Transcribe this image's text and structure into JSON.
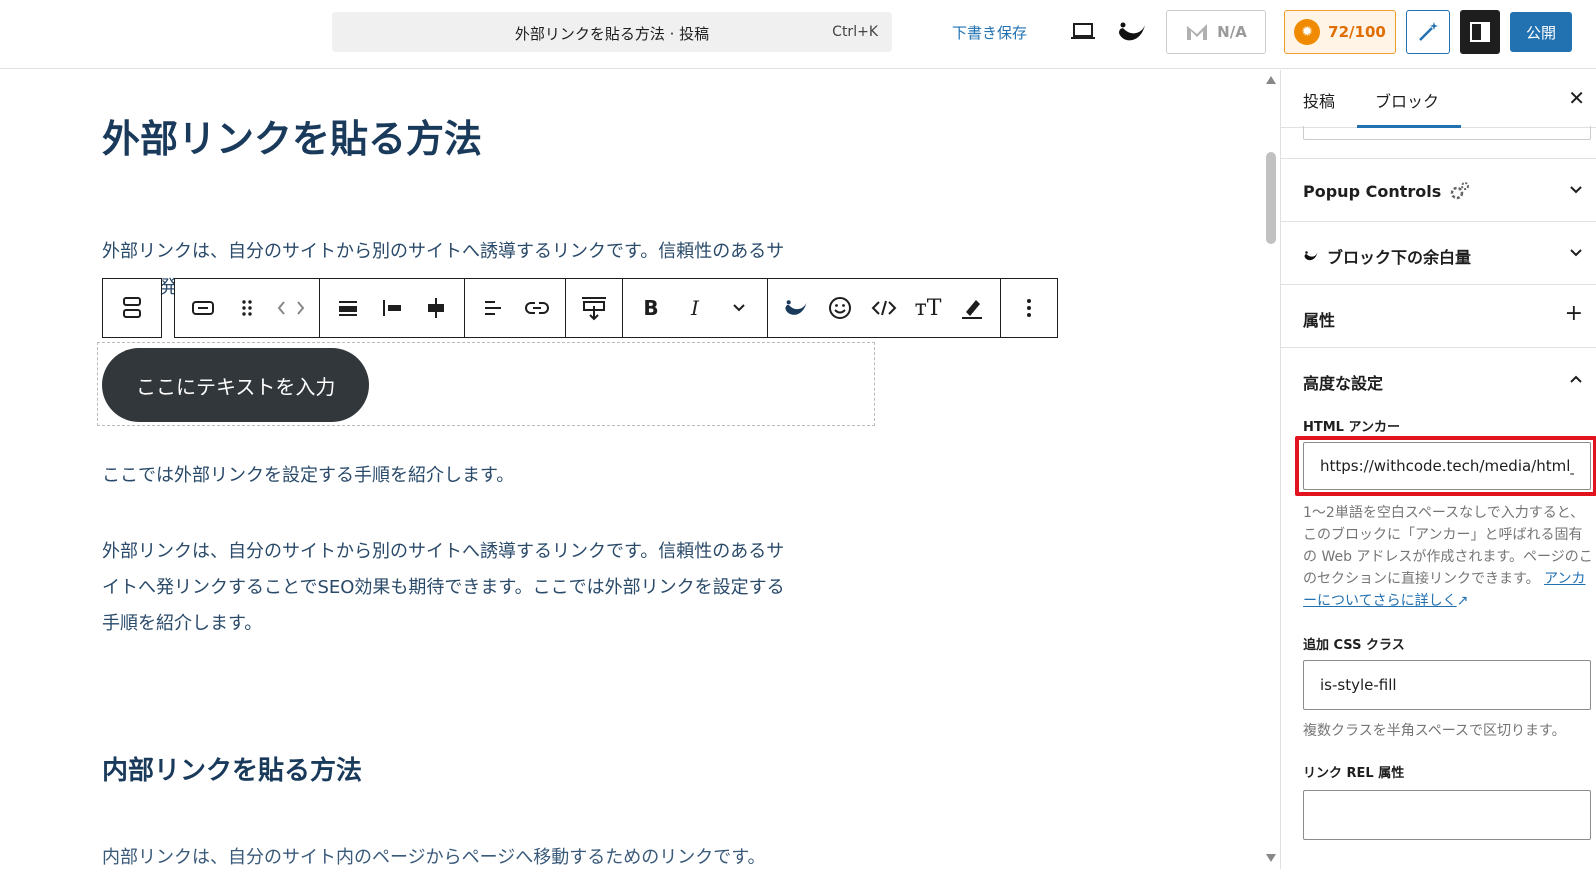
{
  "topbar": {
    "command_title": "外部リンクを貼る方法 · 投稿",
    "command_shortcut": "Ctrl+K",
    "save_draft": "下書き保存",
    "na_label": "N/A",
    "score": "72/100",
    "publish": "公開"
  },
  "editor": {
    "title": "外部リンクを貼る方法",
    "para1_line1": "外部リンクは、自分のサイトから別のサイトへ誘導するリンクです。信頼性のあるサ",
    "para1_peek": "発",
    "button_text": "ここにテキストを入力",
    "para2": "ここでは外部リンクを設定する手順を紹介します。",
    "para3_line1": "外部リンクは、自分のサイトから別のサイトへ誘導するリンクです。信頼性のあるサ",
    "para3_line2": "イトへ発リンクすることでSEO効果も期待できます。ここでは外部リンクを設定する",
    "para3_line3": "手順を紹介します。",
    "heading2": "内部リンクを貼る方法",
    "para4_partial": "内部リンクは、自分のサイト内のページからページへ移動するためのリンクです。"
  },
  "sidebar": {
    "tab_post": "投稿",
    "tab_block": "ブロック",
    "sections": {
      "popup": "Popup Controls",
      "margin": "ブロック下の余白量",
      "attributes": "属性",
      "advanced": "高度な設定"
    },
    "html_anchor_label": "HTML アンカー",
    "html_anchor_value": "https://withcode.tech/media/html_tag",
    "anchor_help": "1〜2単語を空白スペースなしで入力すると、このブロックに「アンカー」と呼ばれる固有の Web アドレスが作成されます。ページのこのセクションに直接リンクできます。",
    "anchor_help_link": "アンカーについてさらに詳しく",
    "css_class_label": "追加 CSS クラス",
    "css_class_value": "is-style-fill",
    "css_class_help": "複数クラスを半角スペースで区切ります。",
    "rel_label": "リンク REL 属性",
    "rel_value": ""
  },
  "colors": {
    "accent": "#2271b1",
    "highlight": "#e0131f",
    "score": "#e06d00",
    "heading": "#1a3a5c"
  }
}
